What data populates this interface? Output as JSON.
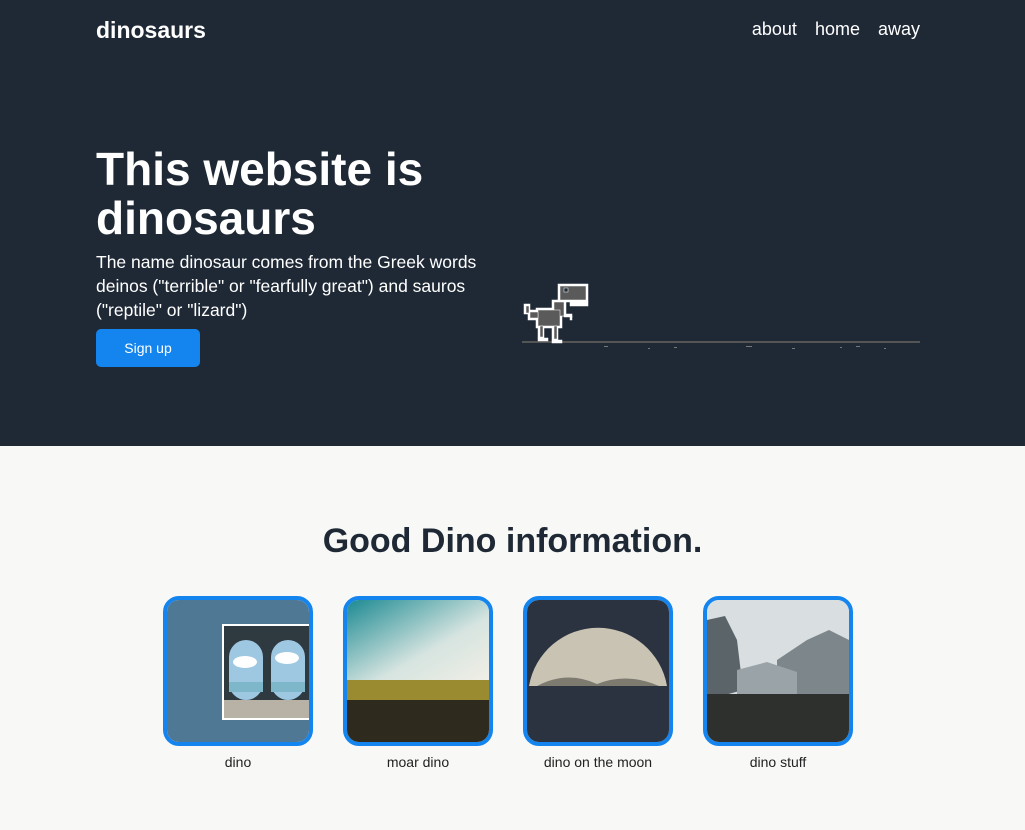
{
  "header": {
    "brand": "dinosaurs",
    "nav": [
      "about",
      "home",
      "away"
    ]
  },
  "hero": {
    "title": "This website is dinosaurs",
    "description": "The name dinosaur comes from the Greek words deinos (\"terrible\" or \"fearfully great\") and sauros (\"reptile\" or \"lizard\")",
    "signup_label": "Sign up"
  },
  "section": {
    "title": "Good Dino information."
  },
  "cards": [
    {
      "label": "dino"
    },
    {
      "label": "moar dino"
    },
    {
      "label": "dino on the moon"
    },
    {
      "label": "dino stuff"
    }
  ],
  "colors": {
    "hero_bg": "#1f2936",
    "accent": "#1485ee",
    "page_bg": "#f8f8f7"
  }
}
